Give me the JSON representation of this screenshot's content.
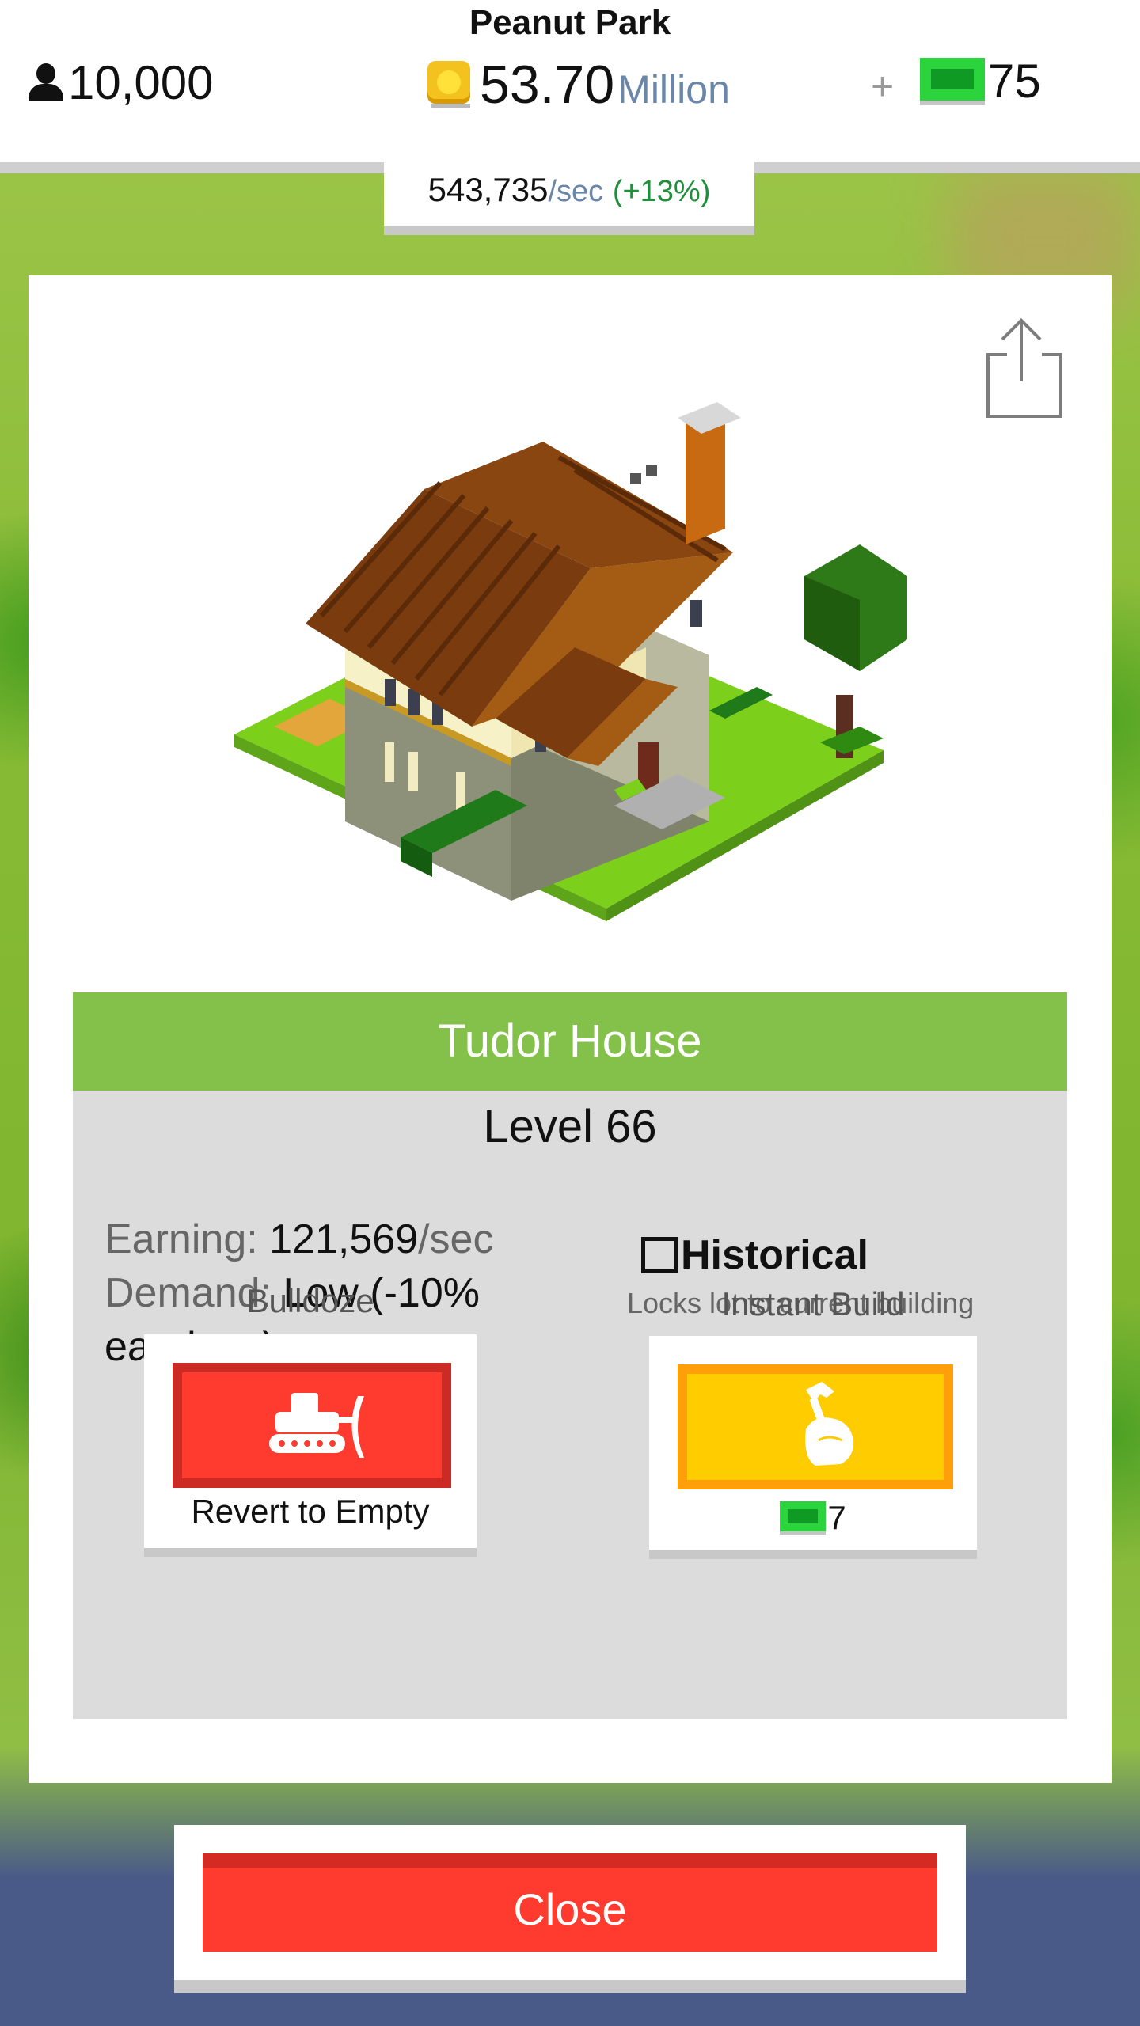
{
  "header": {
    "park_name": "Peanut Park",
    "population": "10,000",
    "money_value": "53.70",
    "money_unit": "Million",
    "plus": "+",
    "cash": "75"
  },
  "income": {
    "value": "543,735",
    "unit": "/sec",
    "bonus": "(+13%)"
  },
  "building": {
    "name": "Tudor House",
    "level": "Level 66",
    "earning_label": "Earning:",
    "earning_value": "121,569",
    "earning_unit": "/sec",
    "demand_label": "Demand:",
    "demand_value": "Low (-10% earnings)"
  },
  "historical": {
    "label": "Historical",
    "description": "Locks lot to current building",
    "checked": false
  },
  "actions": {
    "bulldoze_title": "Bulldoze",
    "bulldoze_label": "Revert to Empty",
    "instant_build_title": "Instant Build",
    "instant_build_cost": "7"
  },
  "close_label": "Close",
  "colors": {
    "title_green": "#84c14a",
    "bulldoze_red": "#ff3b2f",
    "build_yellow": "#ffcc00",
    "cash_green": "#2bd43c"
  },
  "icons": [
    "person-icon",
    "coin-icon",
    "cash-icon",
    "share-icon",
    "bulldozer-icon",
    "hammer-hand-icon",
    "checkbox-icon"
  ]
}
